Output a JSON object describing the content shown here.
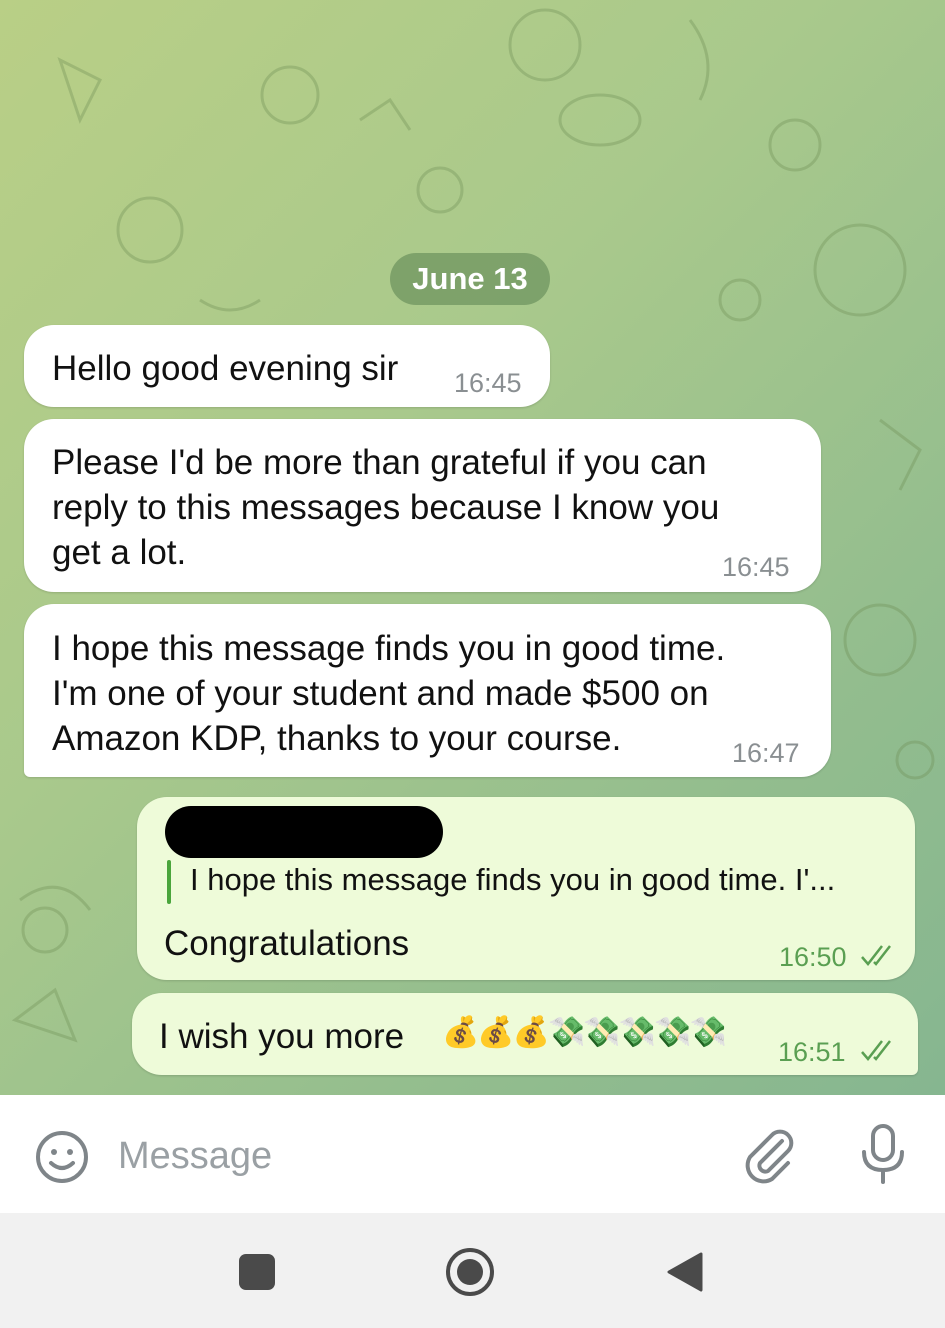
{
  "chat": {
    "date_label": "June 13",
    "messages": [
      {
        "direction": "in",
        "text": "Hello good evening sir",
        "time": "16:45"
      },
      {
        "direction": "in",
        "text": "Please I'd be more than grateful if you can\nreply to this messages because I know you\nget a lot.",
        "time": "16:45"
      },
      {
        "direction": "in",
        "text": "I hope this message finds you in good time.\nI'm one of your student and made $500 on\nAmazon KDP, thanks to your course.",
        "time": "16:47"
      },
      {
        "direction": "out",
        "reply_quote": "I hope this message finds you in good time. I'...",
        "text": "Congratulations",
        "time": "16:50",
        "status": "read"
      },
      {
        "direction": "out",
        "text": "I wish you more",
        "emoji": "💰💰💰💸💸💸💸💸",
        "time": "16:51",
        "status": "read"
      }
    ]
  },
  "composer": {
    "placeholder": "Message",
    "icons": [
      "smiley-icon",
      "paperclip-icon",
      "microphone-icon"
    ]
  },
  "navigation": {
    "icons": [
      "recents-square-icon",
      "home-circle-icon",
      "back-triangle-icon"
    ]
  },
  "colors": {
    "incoming_bubble": "#ffffff",
    "outgoing_bubble": "#eefbd9",
    "outgoing_time": "#5a9f52",
    "date_pill": "#6f9461"
  }
}
